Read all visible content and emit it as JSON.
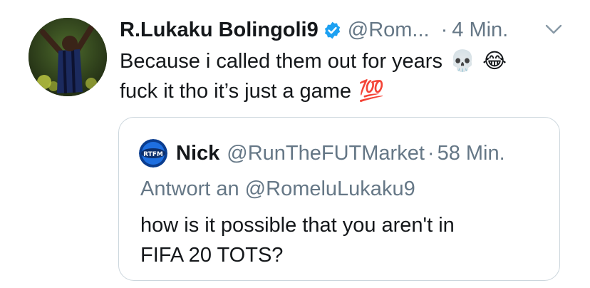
{
  "tweet": {
    "author": {
      "display_name": "R.Lukaku Bolingoli9",
      "handle": "@Rom...",
      "verified": true,
      "avatar_icon": "profile-photo"
    },
    "separator": "·",
    "timestamp": "4 Min.",
    "menu_icon": "chevron-down-icon",
    "text_lines": [
      "Because i called them out for years",
      "fuck it tho it’s just a game"
    ],
    "emojis": {
      "line1": [
        "💀",
        "😂"
      ],
      "line2": [
        "💯"
      ]
    }
  },
  "quoted_tweet": {
    "author": {
      "display_name": "Nick",
      "handle": "@RunTheFUTMarket",
      "avatar_icon": "rtfm-logo"
    },
    "separator": "·",
    "timestamp": "58 Min.",
    "reply_to": "Antwort an @RomeluLukaku9",
    "text_lines": [
      "how is it possible that you aren't in",
      "FIFA 20 TOTS?"
    ]
  },
  "colors": {
    "primary_text": "#14171a",
    "secondary_text": "#657786",
    "verified_blue": "#1da1f2",
    "border": "#ccd6dd"
  }
}
